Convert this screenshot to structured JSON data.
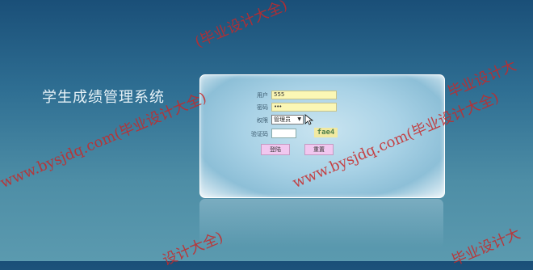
{
  "app": {
    "title": "学生成绩管理系统"
  },
  "login": {
    "username_label": "用户",
    "username_value": "555",
    "password_label": "密码",
    "password_value": "•••",
    "role_label": "权限",
    "role_selected": "管理员",
    "captcha_label": "验证码",
    "captcha_code": "fae4",
    "login_button": "登陆",
    "reset_button": "重置"
  },
  "watermarks": {
    "w1": "www.bysjdq.com(毕业设计大全)",
    "w2": "www.bysjdq.com(毕业设计大全)",
    "w3": "(毕业设计大全)",
    "w4": "www.bysjdq.com(毕业设计大全)",
    "w5": "设计大全)",
    "w6": "毕业设计大"
  },
  "colors": {
    "bg_top": "#1a4f78",
    "bg_bottom": "#5b9aaf",
    "input_bg": "#fbf7b5",
    "button_bg": "#f1c7ef"
  }
}
